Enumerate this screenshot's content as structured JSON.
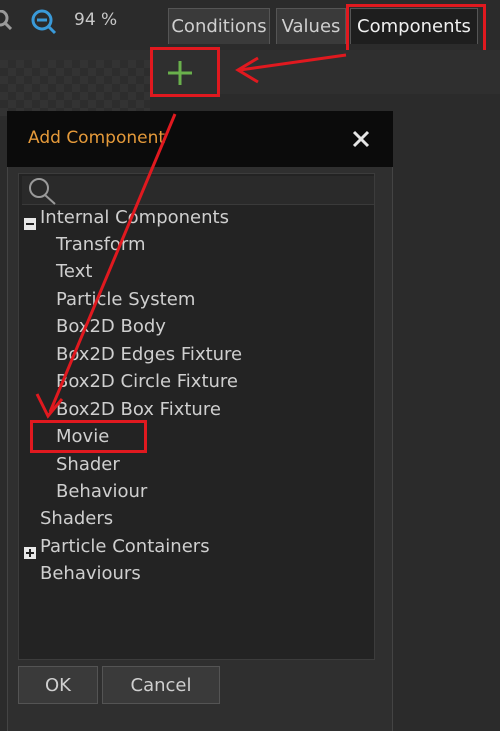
{
  "toolbar": {
    "zoom_level": "94 %",
    "zoom_in_icon": "zoom-in-icon",
    "zoom_out_icon": "zoom-out-icon"
  },
  "tabs": [
    {
      "label": "Conditions"
    },
    {
      "label": "Values"
    },
    {
      "label": "Components",
      "active": true
    }
  ],
  "add_button": {
    "icon": "plus-icon",
    "color": "#6ab04c"
  },
  "dialog": {
    "title": "Add Component",
    "close_icon": "close-icon",
    "search_icon": "search-icon",
    "tree": {
      "internal_label": "Internal Components",
      "internal_items": [
        "Transform",
        "Text",
        "Particle System",
        "Box2D Body",
        "Box2D Edges Fixture",
        "Box2D Circle Fixture",
        "Box2D Box Fixture",
        "Movie",
        "Shader",
        "Behaviour"
      ],
      "shaders_label": "Shaders",
      "particle_containers_label": "Particle Containers",
      "behaviours_label": "Behaviours"
    },
    "ok_label": "OK",
    "cancel_label": "Cancel"
  },
  "colors": {
    "annotation_red": "#e0191f",
    "title_orange": "#e59a3a",
    "zoom_blue": "#3a9ad9"
  }
}
